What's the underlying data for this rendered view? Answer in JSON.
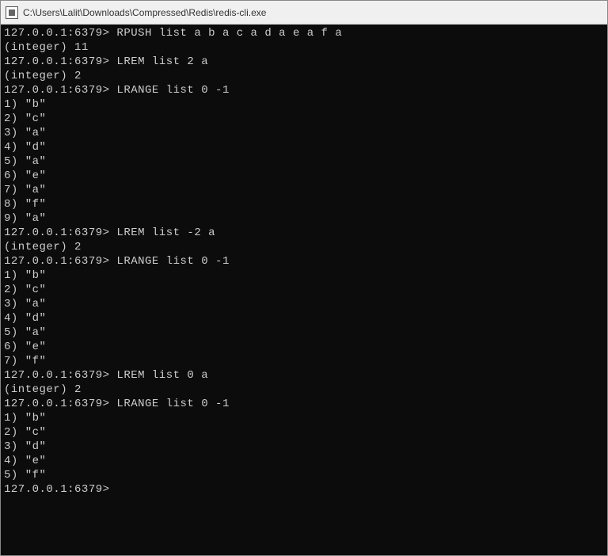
{
  "window": {
    "title": "C:\\Users\\Lalit\\Downloads\\Compressed\\Redis\\redis-cli.exe"
  },
  "prompt": "127.0.0.1:6379>",
  "session": [
    {
      "type": "cmd",
      "text": "RPUSH list a b a c a d a e a f a"
    },
    {
      "type": "out",
      "text": "(integer) 11"
    },
    {
      "type": "cmd",
      "text": "LREM list 2 a"
    },
    {
      "type": "out",
      "text": "(integer) 2"
    },
    {
      "type": "cmd",
      "text": "LRANGE list 0 -1"
    },
    {
      "type": "out",
      "text": "1) \"b\""
    },
    {
      "type": "out",
      "text": "2) \"c\""
    },
    {
      "type": "out",
      "text": "3) \"a\""
    },
    {
      "type": "out",
      "text": "4) \"d\""
    },
    {
      "type": "out",
      "text": "5) \"a\""
    },
    {
      "type": "out",
      "text": "6) \"e\""
    },
    {
      "type": "out",
      "text": "7) \"a\""
    },
    {
      "type": "out",
      "text": "8) \"f\""
    },
    {
      "type": "out",
      "text": "9) \"a\""
    },
    {
      "type": "cmd",
      "text": "LREM list -2 a"
    },
    {
      "type": "out",
      "text": "(integer) 2"
    },
    {
      "type": "cmd",
      "text": "LRANGE list 0 -1"
    },
    {
      "type": "out",
      "text": "1) \"b\""
    },
    {
      "type": "out",
      "text": "2) \"c\""
    },
    {
      "type": "out",
      "text": "3) \"a\""
    },
    {
      "type": "out",
      "text": "4) \"d\""
    },
    {
      "type": "out",
      "text": "5) \"a\""
    },
    {
      "type": "out",
      "text": "6) \"e\""
    },
    {
      "type": "out",
      "text": "7) \"f\""
    },
    {
      "type": "cmd",
      "text": "LREM list 0 a"
    },
    {
      "type": "out",
      "text": "(integer) 2"
    },
    {
      "type": "cmd",
      "text": "LRANGE list 0 -1"
    },
    {
      "type": "out",
      "text": "1) \"b\""
    },
    {
      "type": "out",
      "text": "2) \"c\""
    },
    {
      "type": "out",
      "text": "3) \"d\""
    },
    {
      "type": "out",
      "text": "4) \"e\""
    },
    {
      "type": "out",
      "text": "5) \"f\""
    },
    {
      "type": "prompt",
      "text": ""
    }
  ]
}
